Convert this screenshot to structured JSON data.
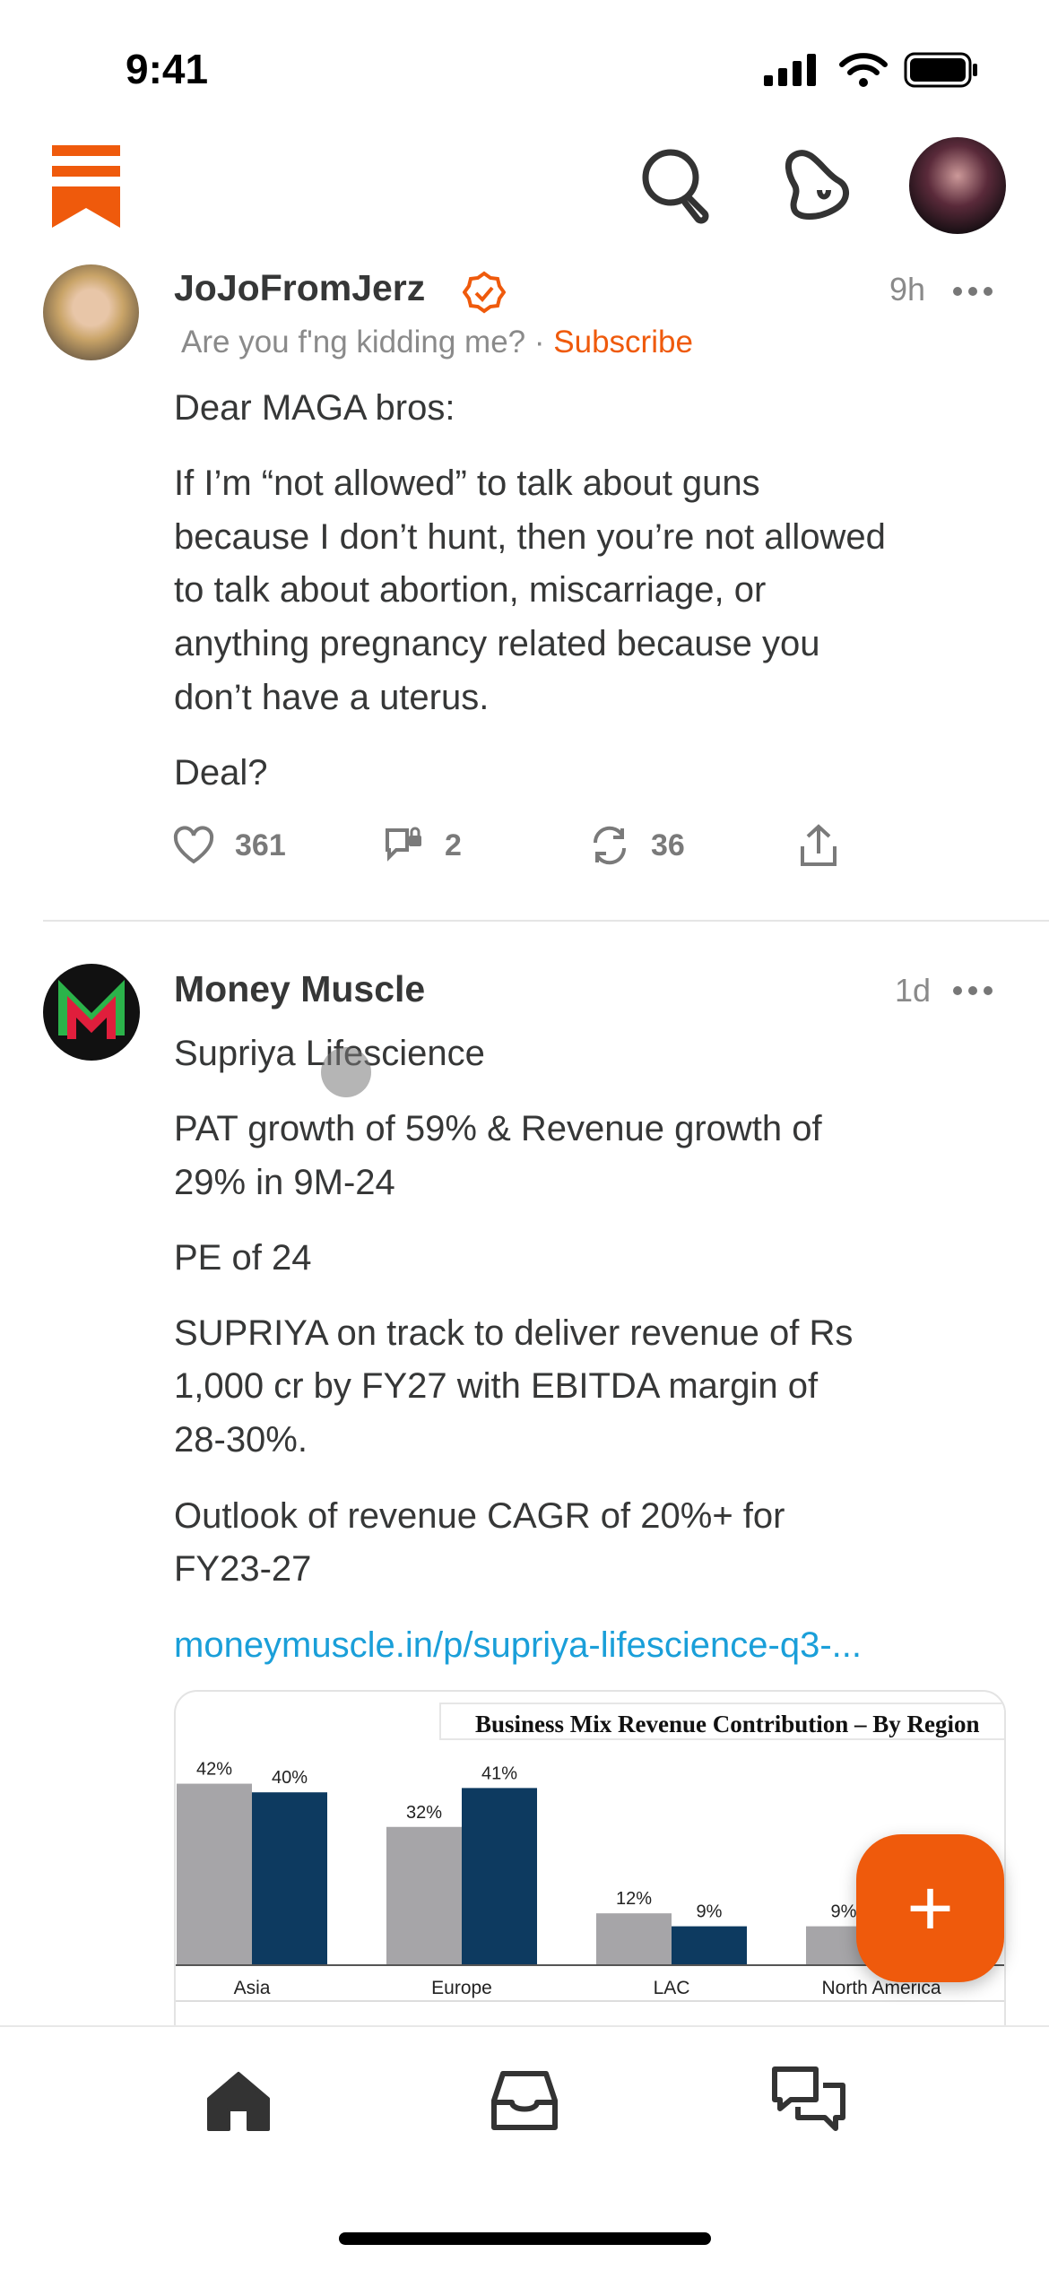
{
  "status": {
    "time": "9:41"
  },
  "colors": {
    "accent": "#ef5a0c",
    "link": "#1a9fd9",
    "bar_gray": "#a6a5a8",
    "bar_navy": "#0d3a60"
  },
  "header": {
    "icons": [
      "substack-logo",
      "search-icon",
      "bell-icon",
      "profile-avatar"
    ]
  },
  "posts": [
    {
      "author": "JoJoFromJerz",
      "verified": true,
      "time": "9h",
      "publication": "Are you f'ng kidding me?",
      "separator": "·",
      "subscribe_label": "Subscribe",
      "body": [
        "Dear MAGA bros:",
        "If I’m “not allowed” to talk about guns",
        "because I don’t hunt, then you’re not allowed",
        "to talk about abortion, miscarriage, or",
        "anything pregnancy related because you",
        "don’t have a uterus.",
        "Deal?"
      ],
      "actions": {
        "likes": "361",
        "comments": "2",
        "restacks": "36"
      }
    },
    {
      "author": "Money Muscle",
      "time": "1d",
      "body": [
        "Supriya Lifescience",
        "PAT growth of 59% & Revenue growth of",
        "29% in 9M-24",
        "PE of 24",
        "SUPRIYA on track to deliver revenue of Rs",
        "1,000 cr by FY27 with EBITDA margin of",
        "28-30%.",
        "Outlook of revenue CAGR of 20%+ for",
        "FY23-27"
      ],
      "link": "moneymuscle.in/p/supriya-lifescience-q3-..."
    }
  ],
  "chart_data": {
    "type": "bar",
    "title": "Business Mix Revenue Contribution – By Region",
    "categories": [
      "Asia",
      "Europe",
      "LAC",
      "North America"
    ],
    "series": [
      {
        "values": [
          42,
          32,
          12,
          9
        ],
        "labels": [
          "42%",
          "32%",
          "12%",
          "9%"
        ]
      },
      {
        "values": [
          40,
          41,
          9,
          null
        ],
        "labels": [
          "40%",
          "41%",
          "9%",
          ""
        ]
      }
    ],
    "ylabel": "",
    "xlabel": ""
  },
  "fab": {
    "label": "+"
  },
  "nav": {
    "items": [
      "home",
      "inbox",
      "chat"
    ]
  }
}
